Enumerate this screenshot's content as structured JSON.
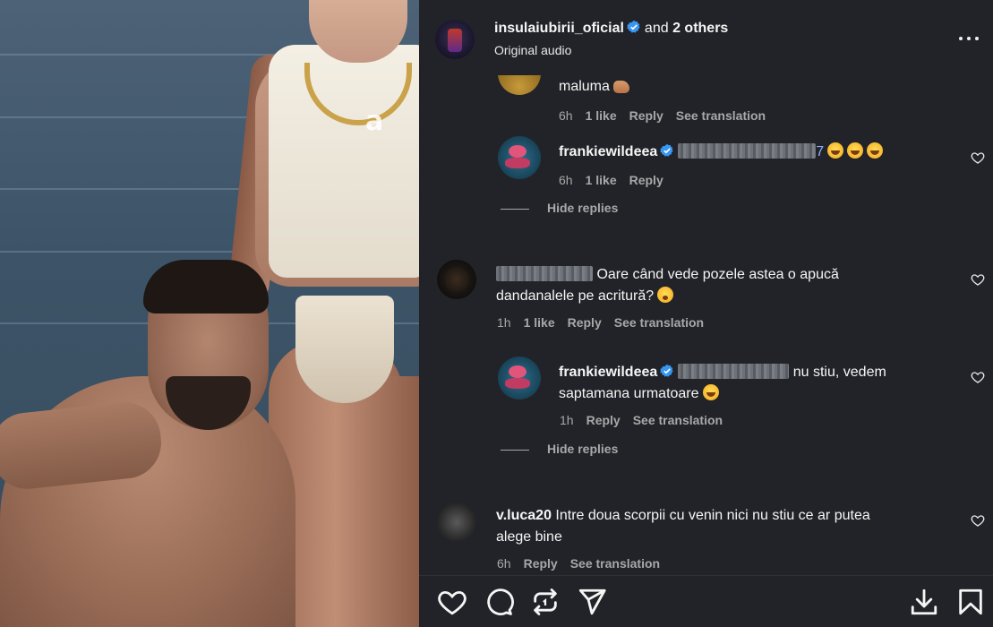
{
  "header": {
    "username": "insulaiubirii_oficial",
    "and_text": "and",
    "others_text": "2 others",
    "subtitle": "Original audio"
  },
  "comments": [
    {
      "text": "maluma",
      "time": "6h",
      "likes": "1 like",
      "reply": "Reply",
      "translate": "See translation"
    },
    {
      "username": "frankiewildeea",
      "mention_suffix": "7",
      "time": "6h",
      "likes": "1 like",
      "reply": "Reply"
    },
    {
      "hide_replies": "Hide replies"
    },
    {
      "text_line1": "Oare când vede pozele astea o apucă",
      "text_line2": "dandanalele pe acritură?",
      "time": "1h",
      "likes": "1 like",
      "reply": "Reply",
      "translate": "See translation"
    },
    {
      "username": "frankiewildeea",
      "text_line1": "nu stiu, vedem",
      "text_line2": "saptamana urmatoare",
      "time": "1h",
      "reply": "Reply",
      "translate": "See translation"
    },
    {
      "hide_replies": "Hide replies"
    },
    {
      "username": "v.luca20",
      "text_line1": "Intre doua scorpii cu venin nici nu stiu ce ar putea",
      "text_line2": "alege bine",
      "time": "6h",
      "reply": "Reply",
      "translate": "See translation"
    }
  ],
  "icons": {
    "like": "heart-icon",
    "comment": "comment-icon",
    "repost": "repost-icon",
    "share": "send-icon",
    "download": "download-icon",
    "save": "bookmark-icon",
    "more": "more-icon",
    "verified": "verified-badge-icon"
  },
  "colors": {
    "panel_bg": "#212328",
    "verified": "#3897f0",
    "muted_text": "#a8a8a8"
  }
}
